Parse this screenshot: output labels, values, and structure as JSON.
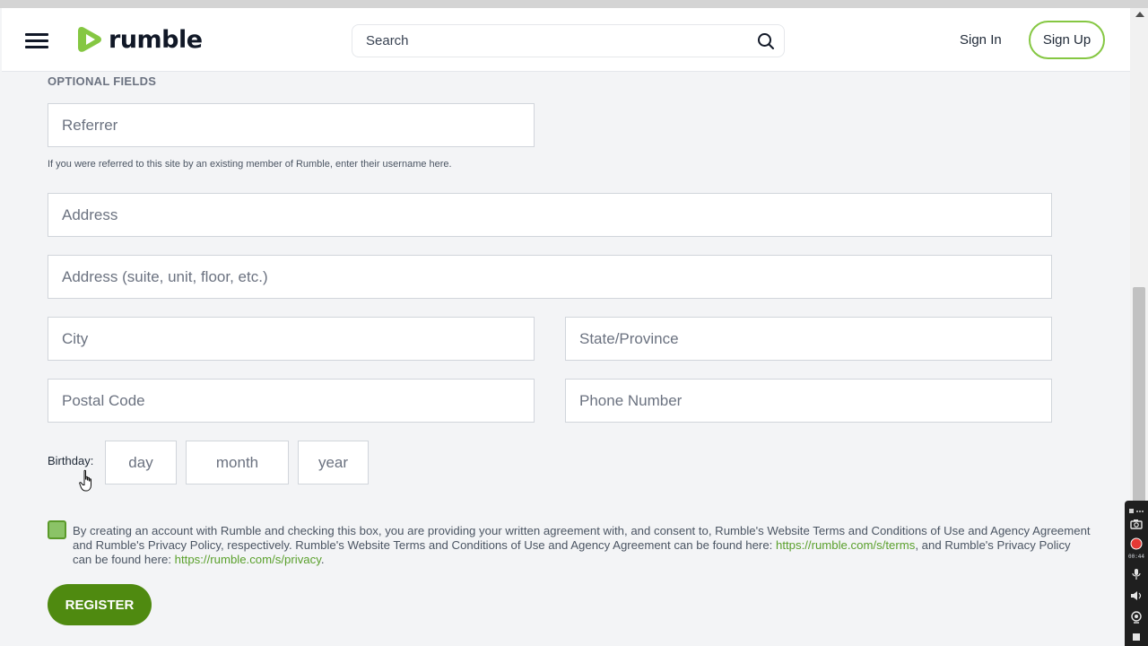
{
  "header": {
    "logo_text": "rumble",
    "search_placeholder": "Search",
    "sign_in": "Sign In",
    "sign_up": "Sign Up"
  },
  "form": {
    "section_label": "OPTIONAL FIELDS",
    "referrer_placeholder": "Referrer",
    "referrer_hint": "If you were referred to this site by an existing member of Rumble, enter their username here.",
    "address_placeholder": "Address",
    "address2_placeholder": "Address (suite, unit, floor, etc.)",
    "city_placeholder": "City",
    "state_placeholder": "State/Province",
    "postal_placeholder": "Postal Code",
    "phone_placeholder": "Phone Number",
    "birthday_label": "Birthday:",
    "day_placeholder": "day",
    "month_placeholder": "month",
    "year_placeholder": "year",
    "consent_part1": "By creating an account with Rumble and checking this box, you are providing your written agreement with, and consent to, Rumble's Website Terms and Conditions of Use and Agency Agreement and Rumble's Privacy Policy, respectively. Rumble's Website Terms and Conditions of Use and Agency Agreement can be found here: ",
    "terms_link": "https://rumble.com/s/terms",
    "consent_part2": ", and Rumble's Privacy Policy can be found here: ",
    "privacy_link": "https://rumble.com/s/privacy",
    "consent_part3": ".",
    "consent_checked": true,
    "register_label": "REGISTER"
  },
  "recorder": {
    "time": "00:44"
  },
  "colors": {
    "brand_green": "#85c742",
    "register_green": "#4f8a10",
    "link_green": "#5aa02c"
  }
}
